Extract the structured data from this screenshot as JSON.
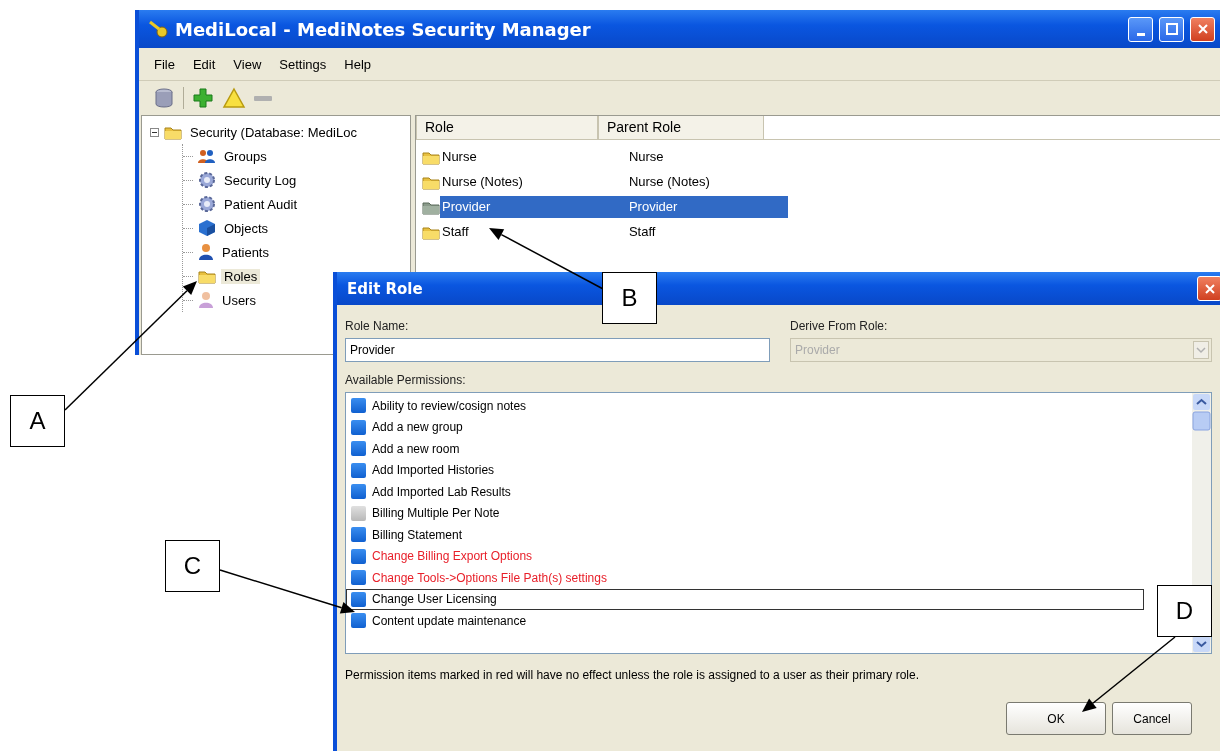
{
  "window": {
    "title": "MediLocal - MediNotes Security Manager"
  },
  "menu": [
    "File",
    "Edit",
    "View",
    "Settings",
    "Help"
  ],
  "tree": {
    "label": "Security (Database: MediLoc",
    "kind": "folder",
    "expanded": true,
    "selected": false,
    "children": [
      {
        "label": "Groups",
        "kind": "group",
        "selected": false
      },
      {
        "label": "Security Log",
        "kind": "gear",
        "selected": false
      },
      {
        "label": "Patient Audit",
        "kind": "gear",
        "selected": false
      },
      {
        "label": "Objects",
        "kind": "cube",
        "selected": false
      },
      {
        "label": "Patients",
        "kind": "person",
        "selected": false
      },
      {
        "label": "Roles",
        "kind": "folder",
        "selected": true
      },
      {
        "label": "Users",
        "kind": "user",
        "selected": false
      }
    ]
  },
  "role_list": {
    "columns": [
      "Role",
      "Parent Role"
    ],
    "rows": [
      {
        "role": "Nurse",
        "parent_role": "Nurse",
        "selected": false
      },
      {
        "role": "Nurse (Notes)",
        "parent_role": "Nurse (Notes)",
        "selected": false
      },
      {
        "role": "Provider",
        "parent_role": "Provider",
        "selected": true
      },
      {
        "role": "Staff",
        "parent_role": "Staff",
        "selected": false
      }
    ]
  },
  "dialog": {
    "title": "Edit Role",
    "role_name": {
      "label": "Role Name:",
      "value": "Provider"
    },
    "derive_from": {
      "label": "Derive From Role:",
      "value": "Provider",
      "disabled": true
    },
    "permissions": {
      "label": "Available Permissions:",
      "items": [
        {
          "label": "Ability to review/cosign notes",
          "checked": true,
          "color": "#000000",
          "selected": false
        },
        {
          "label": "Add a new group",
          "checked": true,
          "color": "#000000",
          "selected": false
        },
        {
          "label": "Add a new room",
          "checked": true,
          "color": "#000000",
          "selected": false
        },
        {
          "label": "Add Imported Histories",
          "checked": true,
          "color": "#000000",
          "selected": false
        },
        {
          "label": "Add Imported Lab Results",
          "checked": true,
          "color": "#000000",
          "selected": false
        },
        {
          "label": "Billing Multiple Per Note",
          "checked": false,
          "color": "#000000",
          "selected": false
        },
        {
          "label": "Billing Statement",
          "checked": true,
          "color": "#000000",
          "selected": false
        },
        {
          "label": "Change Billing Export Options",
          "checked": true,
          "color": "#e8202a",
          "selected": false
        },
        {
          "label": "Change Tools->Options File Path(s) settings",
          "checked": true,
          "color": "#e8202a",
          "selected": false
        },
        {
          "label": "Change User Licensing",
          "checked": true,
          "color": "#000000",
          "selected": true
        },
        {
          "label": "Content update maintenance",
          "checked": true,
          "color": "#000000",
          "selected": false
        }
      ]
    },
    "note": "Permission items marked in red will have no effect unless the role is assigned to a user as their primary role.",
    "buttons": [
      "OK",
      "Cancel"
    ]
  },
  "callouts": [
    {
      "label": "A"
    },
    {
      "label": "B"
    },
    {
      "label": "C"
    },
    {
      "label": "D"
    }
  ]
}
